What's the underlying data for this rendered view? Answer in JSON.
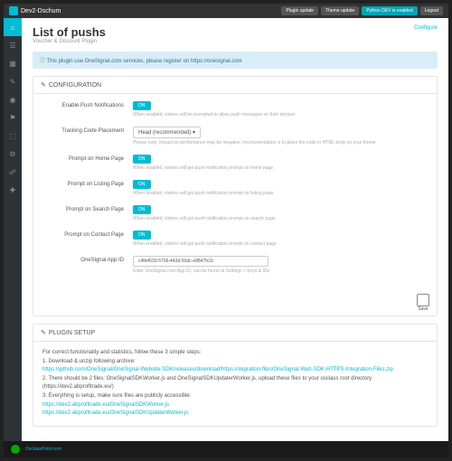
{
  "topbar": {
    "brand": "Dev2-Dschum",
    "badges": [
      "Plugin update",
      "Theme update",
      "Python DEV is enabled"
    ],
    "logout": "Logout"
  },
  "header": {
    "title": "List of pushs",
    "subtitle": "Voucher & Discount Plugin",
    "configure": "Configure"
  },
  "info": {
    "text": "This plugin use OneSignal.com services, please register on https://onesignal.com"
  },
  "config": {
    "heading": "CONFIGURATION",
    "rows": [
      {
        "label": "Enable Push Notifications",
        "type": "toggle",
        "val": "ON",
        "help": "When enabled, visitors will be prompted to allow push messages on their devices"
      },
      {
        "label": "Tracking Code Placement",
        "type": "select",
        "val": "Head (recommended)",
        "help": "Please note, impact on performance may be negative, recommendation is to place the code in HTML body on your theme"
      },
      {
        "label": "Prompt on Home Page",
        "type": "toggle",
        "val": "ON",
        "help": "When enabled, visitors will get push notification prompt on home page"
      },
      {
        "label": "Prompt on Listing Page",
        "type": "toggle",
        "val": "ON",
        "help": "When enabled, visitors will get push notification prompt on listing page"
      },
      {
        "label": "Prompt on Search Page",
        "type": "toggle",
        "val": "ON",
        "help": "When enabled, visitors will get push notification prompt on search page"
      },
      {
        "label": "Prompt on Contact Page",
        "type": "toggle",
        "val": "ON",
        "help": "When enabled, visitors will get push notification prompt on contact page"
      },
      {
        "label": "OneSignal App ID",
        "type": "input",
        "val": "c4fd4533-5706-442d-91dc-e8847fc2c",
        "help": "Enter OneSignal.com App ID, can be found at Settings > Keys & IDs"
      }
    ],
    "save": "Save"
  },
  "setup": {
    "heading": "PLUGIN SETUP",
    "intro": "For correct functionality and statistics, follow these 3 simple steps:",
    "step1": "1. Download & unzip following archive:",
    "link1": "https://github.com/OneSignal/OneSignal-Website-SDK/releases/download/https-integration-files/OneSignal-Web-SDK-HTTPS-Integration-Files.zip",
    "step2": "2. There should be 2 files: OneSignalSDKWorker.js and OneSignalSDKUpdaterWorker.js, upload these files to your osclass root directory (https://dev2.abprofitrade.eu/)",
    "step3": "3. Everything is setup, make sure files are publicly accessible:",
    "link3a": "https://dev2.abprofitrade.eu/OneSignalSDKWorker.js",
    "link3b": "https://dev2.abprofitrade.eu/OneSignalSDKUpdaterWorker.js"
  },
  "footer": {
    "brand": "OsclassPoint.com"
  }
}
